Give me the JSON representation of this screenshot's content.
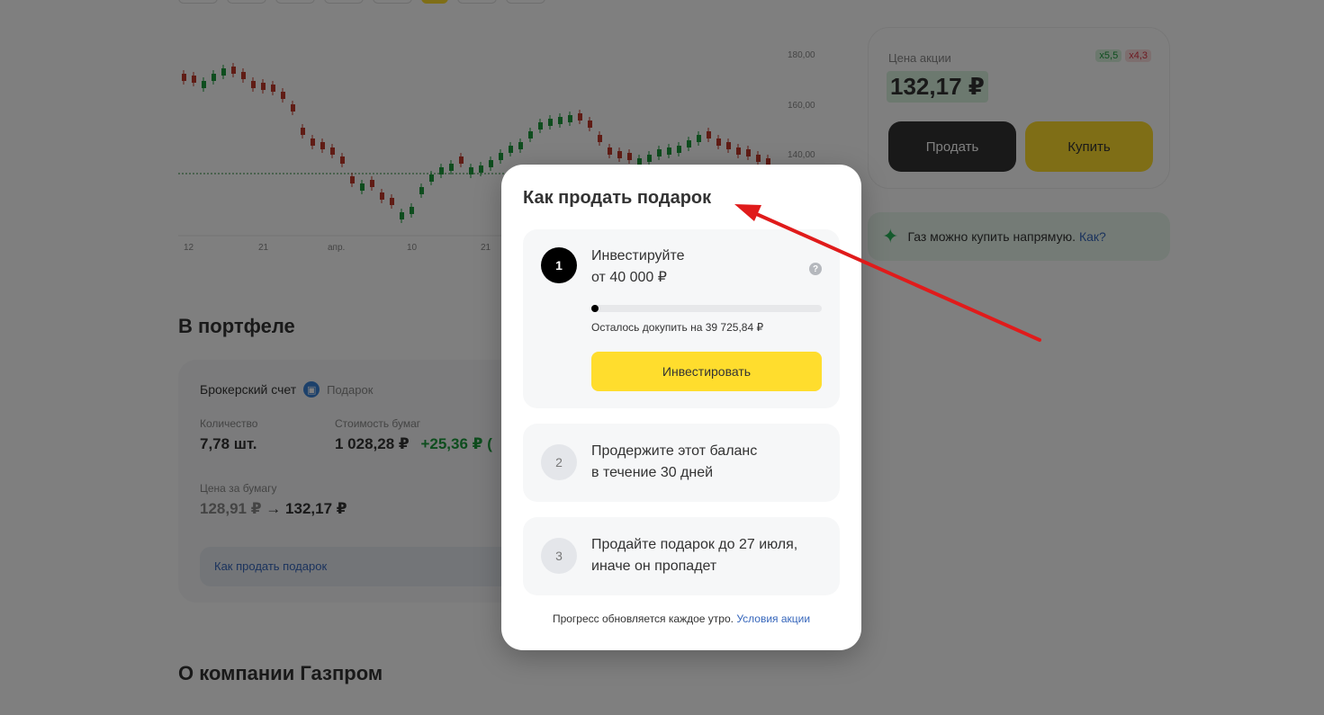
{
  "chart": {
    "y_ticks": [
      "180,00",
      "160,00",
      "140,00"
    ],
    "x_ticks": [
      "12",
      "21",
      "апр.",
      "10",
      "21"
    ]
  },
  "portfolio": {
    "heading": "В портфеле",
    "account": "Брокерский счет",
    "gift_label": "Подарок",
    "quantity_label": "Количество",
    "quantity_value": "7,78 шт.",
    "cost_label": "Стоимость бумаг",
    "cost_value": "1 028,28 ₽",
    "cost_change": "+25,36 ₽ (",
    "price_per_share_label": "Цена за бумагу",
    "price_from": "128,91 ₽",
    "arrow": "→",
    "price_to": "132,17 ₽",
    "how_to_sell_link": "Как продать подарок"
  },
  "company": {
    "heading": "О компании Газпром"
  },
  "price_card": {
    "label": "Цена акции",
    "value": "132,17 ₽",
    "badge_green": "x5,5",
    "badge_red": "x4,3",
    "sell": "Продать",
    "buy": "Купить"
  },
  "direct": {
    "text": "Газ можно купить напрямую.",
    "link": "Как?"
  },
  "modal": {
    "title": "Как продать подарок",
    "steps": [
      {
        "num": "1",
        "line1": "Инвестируйте",
        "line2": "от 40 000 ₽"
      },
      {
        "num": "2",
        "line1": "Продержите этот баланс",
        "line2": "в течение 30 дней"
      },
      {
        "num": "3",
        "line1": "Продайте подарок до 27 июля,",
        "line2": "иначе он пропадет"
      }
    ],
    "help": "?",
    "progress_fraction": 0.0069,
    "remaining": "Осталось докупить на 39 725,84 ₽",
    "invest_button": "Инвестировать",
    "footer_text": "Прогресс обновляется каждое утро.",
    "footer_link": "Условия акции"
  },
  "colors": {
    "accent_yellow": "#ffdd2d",
    "arrow_red": "#e01b1b",
    "link_blue": "#3666bb",
    "up_green": "#1c9b3c",
    "down_red": "#c0392b"
  }
}
